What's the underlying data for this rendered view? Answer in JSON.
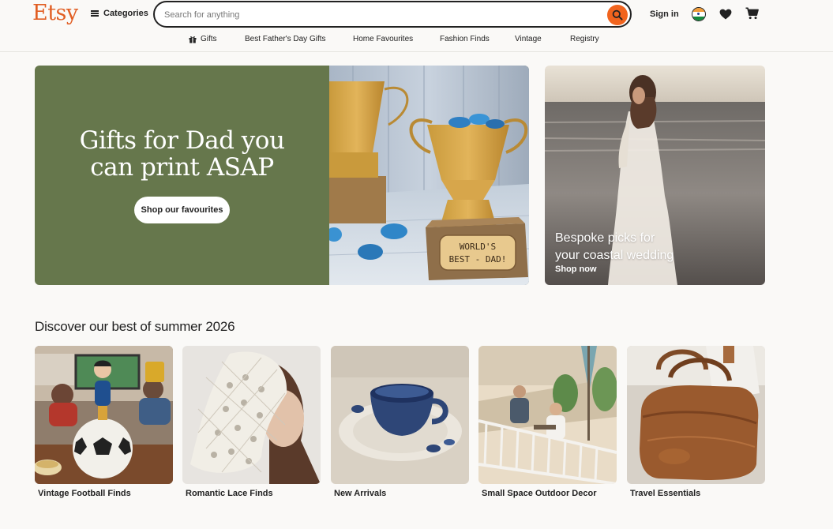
{
  "brand": {
    "logo_text": "Etsy",
    "accent_color": "#f1641e",
    "hero_green": "#66774c"
  },
  "header": {
    "categories_label": "Categories",
    "search_placeholder": "Search for anything",
    "search_value": "",
    "signin_label": "Sign in",
    "icons": [
      "hamburger-icon",
      "search-icon",
      "india-flag-icon",
      "heart-icon",
      "cart-icon"
    ]
  },
  "subnav": {
    "items": [
      {
        "label": "Gifts",
        "icon": "gift-icon"
      },
      {
        "label": "Best Father's Day Gifts"
      },
      {
        "label": "Home Favourites"
      },
      {
        "label": "Fashion Finds"
      },
      {
        "label": "Vintage"
      },
      {
        "label": "Registry"
      }
    ]
  },
  "hero": {
    "main": {
      "title_line1": "Gifts for Dad you",
      "title_line2": "can print ASAP",
      "cta_label": "Shop our favourites",
      "photo_caption": "WORLD'S BEST - DAD!"
    },
    "side": {
      "title_line1": "Bespoke picks for",
      "title_line2": "your coastal wedding",
      "link_label": "Shop now"
    }
  },
  "discover": {
    "title": "Discover our best of summer 2026",
    "cards": [
      {
        "label": "Vintage Football Finds"
      },
      {
        "label": "Romantic Lace Finds"
      },
      {
        "label": "New Arrivals"
      },
      {
        "label": "Small Space Outdoor Decor"
      },
      {
        "label": "Travel Essentials"
      }
    ]
  }
}
